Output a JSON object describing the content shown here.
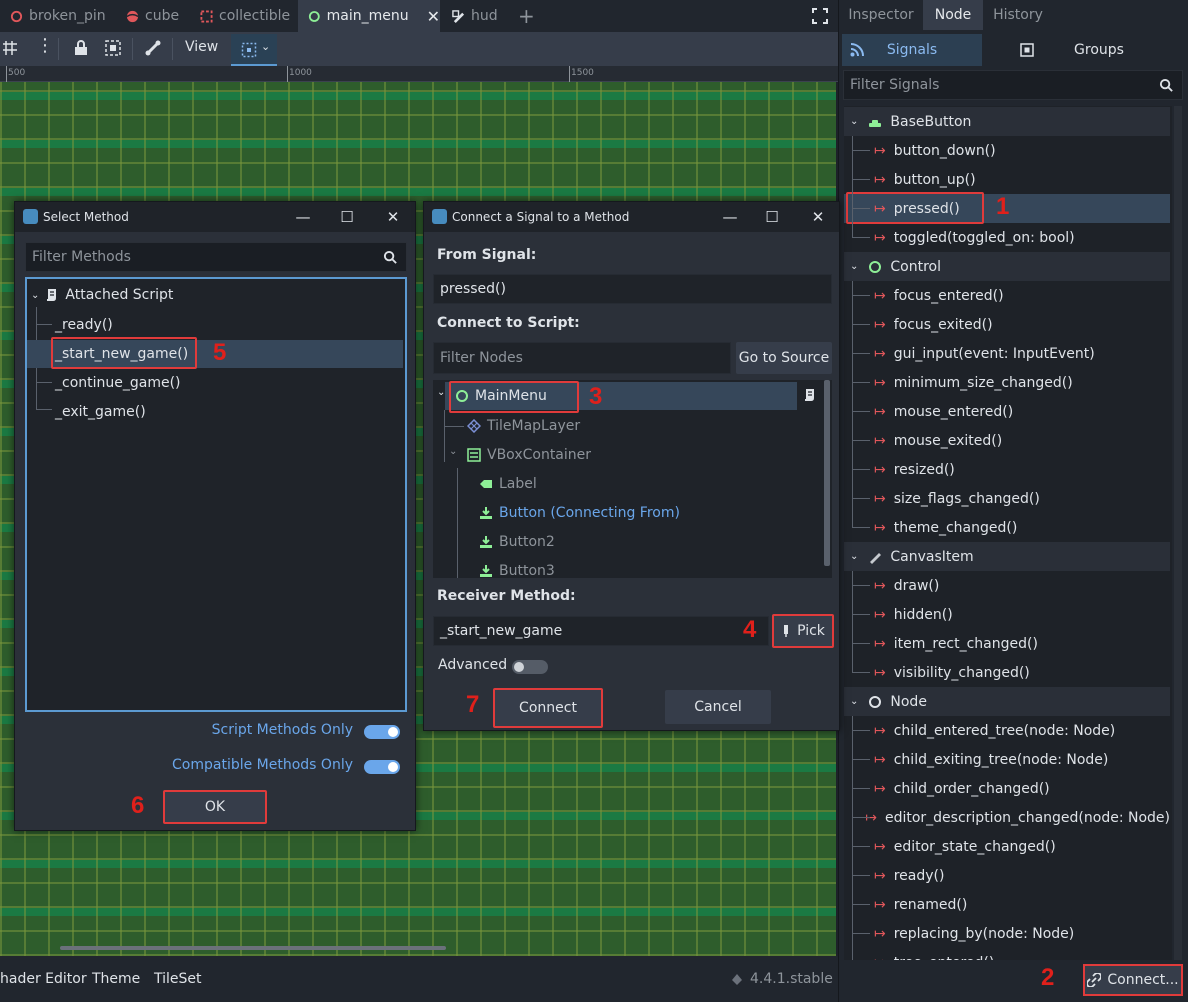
{
  "scene_tabs": [
    {
      "label": "broken_pin",
      "icon": "circle-icon",
      "color": "#e0575b"
    },
    {
      "label": "cube",
      "icon": "sphere-icon",
      "color": "#e0575b"
    },
    {
      "label": "collectible",
      "icon": "area-icon",
      "color": "#e0575b"
    },
    {
      "label": "main_menu",
      "icon": "control-circle-icon",
      "color": "#8eef97",
      "active": true
    },
    {
      "label": "hud",
      "icon": "canvas-icon",
      "color": "#dfe3e8"
    }
  ],
  "toolbar": {
    "view_label": "View"
  },
  "ruler": {
    "labels": [
      "500",
      "1000",
      "1500"
    ]
  },
  "bottom_bar": {
    "items": [
      "hader Editor",
      "Theme",
      "TileSet"
    ],
    "version": "4.4.1.stable"
  },
  "dock": {
    "tabs": [
      "Inspector",
      "Node",
      "History"
    ],
    "active_tab": "Node",
    "segments": [
      "Signals",
      "Groups"
    ],
    "filter_placeholder": "Filter Signals",
    "categories": [
      {
        "name": "BaseButton",
        "signals": [
          "button_down()",
          "button_up()",
          "pressed()",
          "toggled(toggled_on: bool)"
        ]
      },
      {
        "name": "Control",
        "signals": [
          "focus_entered()",
          "focus_exited()",
          "gui_input(event: InputEvent)",
          "minimum_size_changed()",
          "mouse_entered()",
          "mouse_exited()",
          "resized()",
          "size_flags_changed()",
          "theme_changed()"
        ]
      },
      {
        "name": "CanvasItem",
        "signals": [
          "draw()",
          "hidden()",
          "item_rect_changed()",
          "visibility_changed()"
        ]
      },
      {
        "name": "Node",
        "signals": [
          "child_entered_tree(node: Node)",
          "child_exiting_tree(node: Node)",
          "child_order_changed()",
          "editor_description_changed(node: Node)",
          "editor_state_changed()",
          "ready()",
          "renamed()",
          "replacing_by(node: Node)",
          "tree_entered()"
        ]
      }
    ],
    "selected_signal": "pressed()",
    "connect_label": "Connect..."
  },
  "select_method": {
    "title": "Select Method",
    "filter_placeholder": "Filter Methods",
    "group": "Attached Script",
    "methods": [
      "_ready()",
      "_start_new_game()",
      "_continue_game()",
      "_exit_game()"
    ],
    "selected": "_start_new_game()",
    "script_only_label": "Script Methods Only",
    "script_only_on": true,
    "compatible_label": "Compatible Methods Only",
    "compatible_on": true,
    "ok_label": "OK"
  },
  "connect_dialog": {
    "title": "Connect a Signal to a Method",
    "from_signal_label": "From Signal:",
    "from_signal_value": "pressed()",
    "connect_to_script_label": "Connect to Script:",
    "filter_nodes_placeholder": "Filter Nodes",
    "go_to_source_label": "Go to Source",
    "nodes": [
      {
        "label": "MainMenu",
        "icon": "control-circle-icon",
        "icon_color": "#8eef97",
        "color": "#dfe3e8"
      },
      {
        "label": "TileMapLayer",
        "icon": "tilemap-icon",
        "icon_color": "#7b8fd4",
        "color": "#8e949b"
      },
      {
        "label": "VBoxContainer",
        "icon": "vbox-icon",
        "icon_color": "#8eef97",
        "color": "#8e949b"
      },
      {
        "label": "Label",
        "icon": "label-icon",
        "icon_color": "#8eef97",
        "color": "#8e949b"
      },
      {
        "label": "Button (Connecting From)",
        "icon": "button-icon",
        "icon_color": "#8eef97",
        "color": "#6aa6ea"
      },
      {
        "label": "Button2",
        "icon": "button-icon",
        "icon_color": "#8eef97",
        "color": "#8e949b"
      },
      {
        "label": "Button3",
        "icon": "button-icon",
        "icon_color": "#8eef97",
        "color": "#8e949b"
      }
    ],
    "receiver_method_label": "Receiver Method:",
    "receiver_method_value": "_start_new_game",
    "pick_label": "Pick",
    "advanced_label": "Advanced",
    "advanced_on": false,
    "connect_label": "Connect",
    "cancel_label": "Cancel"
  },
  "annotations": [
    "1",
    "2",
    "3",
    "4",
    "5",
    "6",
    "7"
  ],
  "colors": {
    "annotation": "#e0201b",
    "signal_arrow": "#e0575b",
    "accent": "#6aa6ea"
  }
}
